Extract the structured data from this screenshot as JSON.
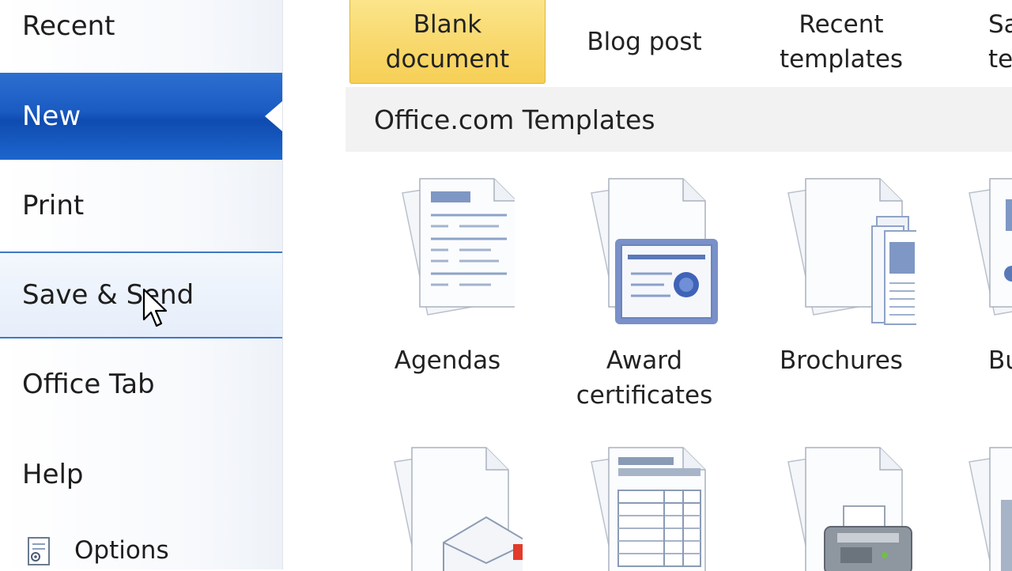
{
  "nav": {
    "recent": "Recent",
    "new": "New",
    "print": "Print",
    "save_send": "Save & Send",
    "office_tab": "Office Tab",
    "help": "Help",
    "options": "Options"
  },
  "quick_templates": [
    {
      "label": "Blank\ndocument",
      "selected": true
    },
    {
      "label": "Blog post"
    },
    {
      "label": "Recent\ntemplates"
    },
    {
      "label": "Sa\nte"
    }
  ],
  "section": {
    "title": "Office.com Templates"
  },
  "templates_row1": [
    {
      "label": "Agendas",
      "icon": "agenda-document-icon"
    },
    {
      "label": "Award\ncertificates",
      "icon": "award-certificate-icon"
    },
    {
      "label": "Brochures",
      "icon": "brochure-icon"
    },
    {
      "label": "Bu",
      "icon": "budget-icon"
    }
  ],
  "templates_row2": [
    {
      "icon": "envelope-document-icon"
    },
    {
      "icon": "table-form-icon"
    },
    {
      "icon": "fax-machine-icon"
    },
    {
      "icon": "partial-template-icon"
    }
  ],
  "colors": {
    "nav_selected": "#1a5bc2",
    "quick_selected": "#f8d76a",
    "section_bg": "#f2f2f2"
  }
}
